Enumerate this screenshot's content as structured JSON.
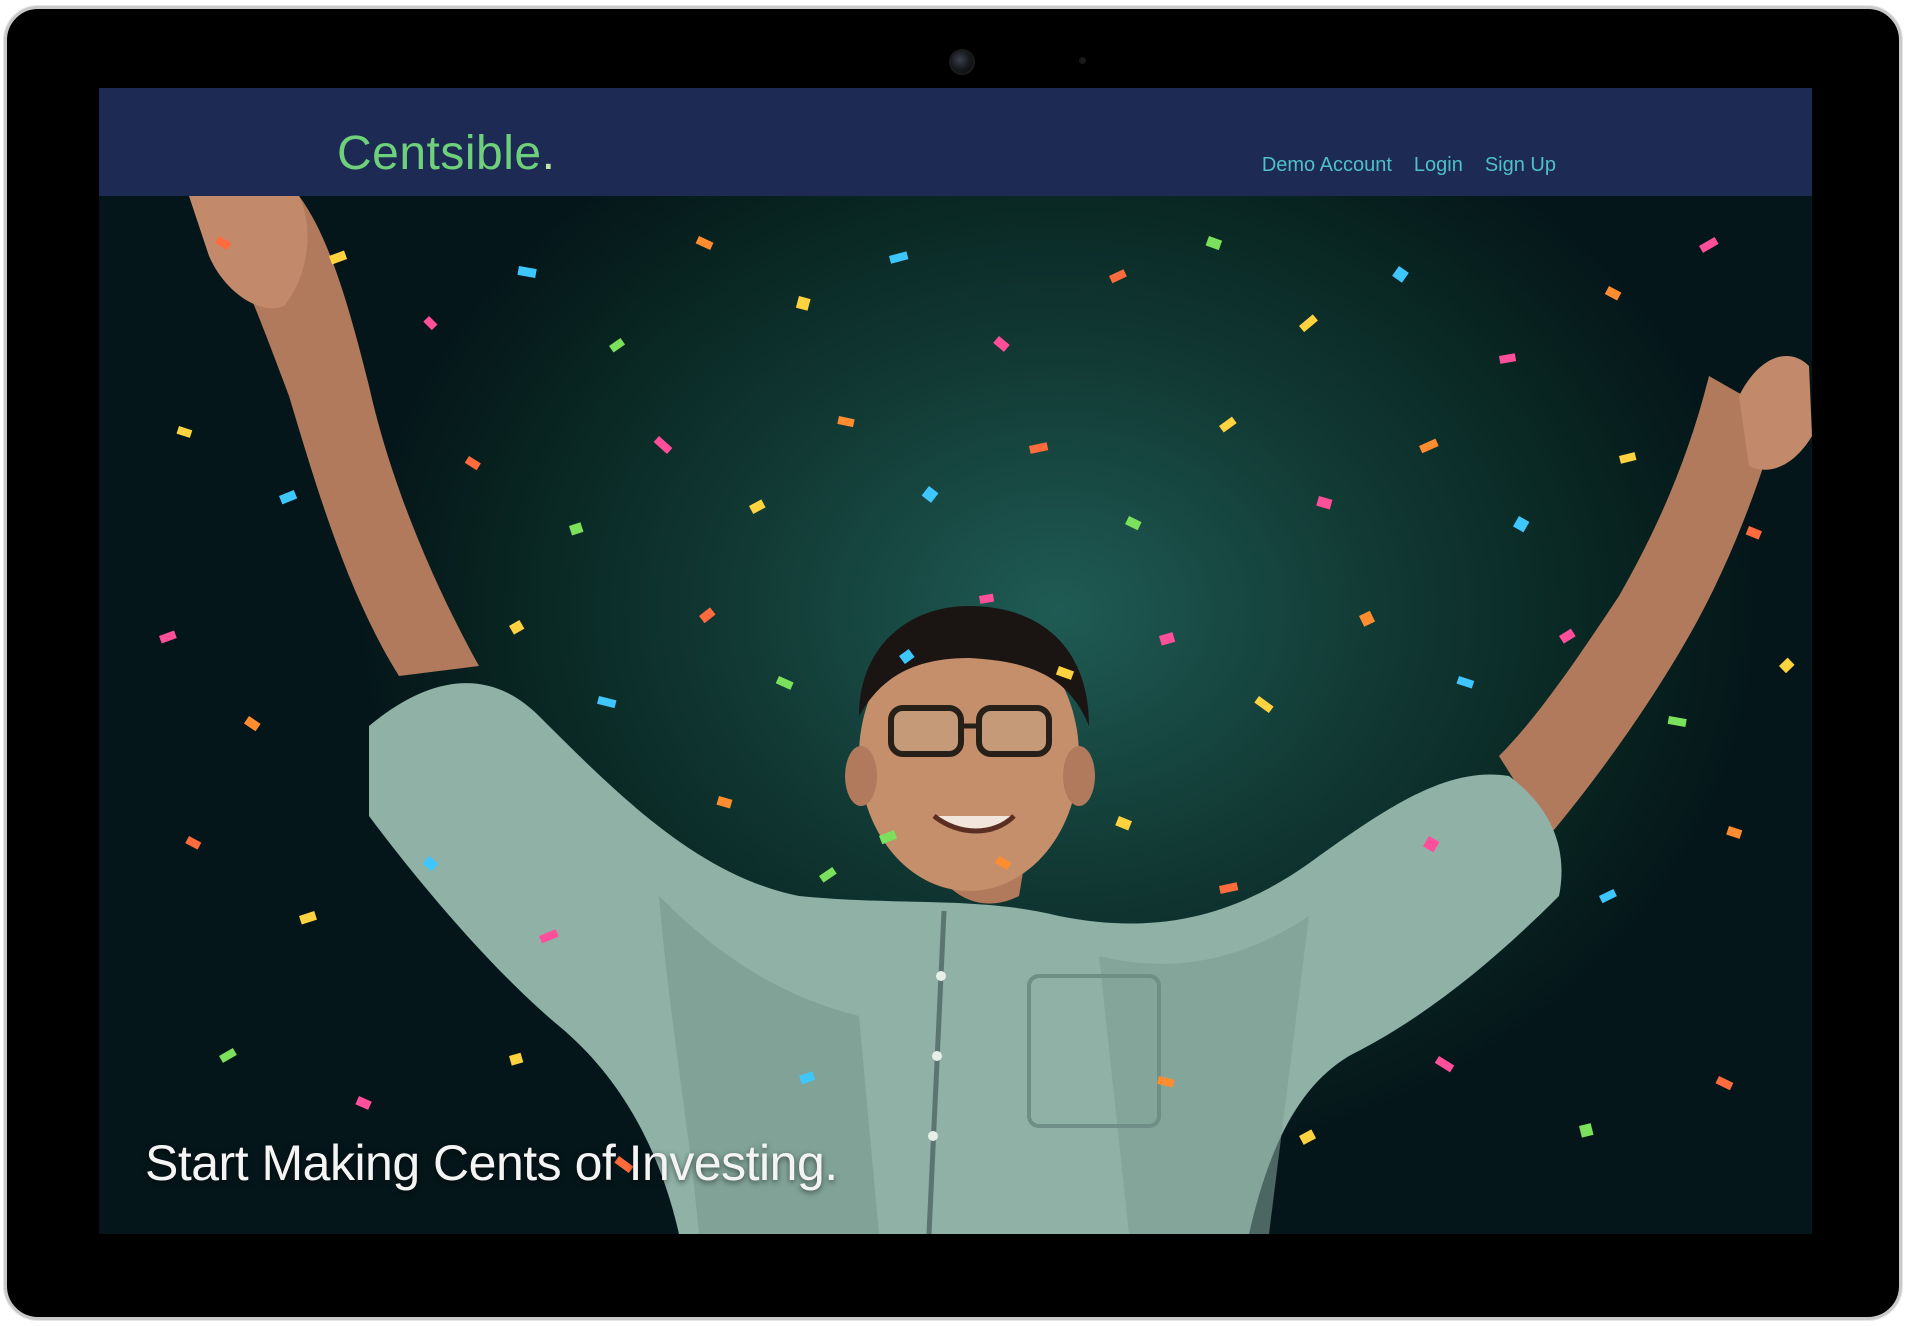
{
  "app": {
    "logo_text": "Centsible",
    "logo_dot": "."
  },
  "nav": {
    "links": [
      {
        "label": "Demo Account"
      },
      {
        "label": "Login"
      },
      {
        "label": "Sign Up"
      }
    ]
  },
  "hero": {
    "tagline": "Start Making Cents of Investing.",
    "image_description_icon": "confetti-celebration-photo"
  },
  "colors": {
    "navbar_bg": "#1c2a54",
    "logo": "#6ed07a",
    "nav_link": "#4fc0c4",
    "tagline": "#f4f4f4"
  }
}
